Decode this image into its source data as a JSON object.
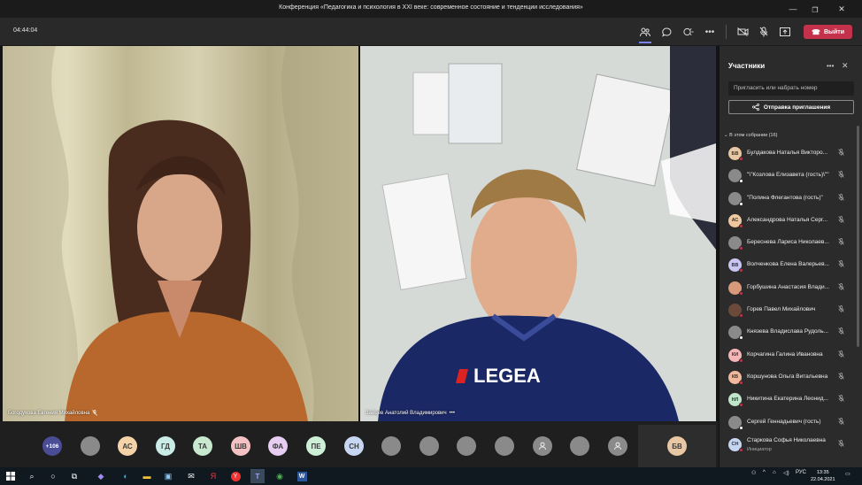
{
  "window": {
    "title": "Конференция «Педагогика и психология в XXI веке: современное состояние и тенденции исследования»",
    "minimize": "—",
    "maximize": "❐",
    "close": "✕"
  },
  "toolbar": {
    "timer": "04:44:04",
    "leave_label": "Выйти"
  },
  "videos": [
    {
      "name": "Богодухова Евгения Михайловна"
    },
    {
      "name": "Зайцев Анатолий Владимирович"
    }
  ],
  "strip": {
    "overflow": "+106",
    "initials": [
      "АС",
      "ГД",
      "ТА",
      "ШВ",
      "ФА",
      "ПЕ",
      "СН"
    ],
    "active_speaker": "БВ"
  },
  "panel": {
    "title": "Участники",
    "invite_placeholder": "Пригласить или набрать номер",
    "share_label": "Отправка приглашения",
    "section_label": "В этом собрании (16)",
    "participants": [
      {
        "initials": "БВ",
        "name": "Булдакова Наталья Викторо...",
        "color": "#e8c7a4",
        "status": "#c4314b"
      },
      {
        "initials": "",
        "name": "\"\\\"Козлова Елизавета (гость)\\\"\"",
        "color": "#8a8a8a",
        "status": "#ffffff"
      },
      {
        "initials": "",
        "name": "\"Полина Флегантова (гость)\"",
        "color": "#8a8a8a",
        "status": "#ffffff"
      },
      {
        "initials": "АС",
        "name": "Александрова Наталья Серг...",
        "color": "#f0c8a0",
        "status": "#c4314b"
      },
      {
        "initials": "",
        "name": "Береснева Лариса Николаев...",
        "color": "#8a8a8a",
        "status": "#c4314b"
      },
      {
        "initials": "ВВ",
        "name": "Волченкова Елена Валерьев...",
        "color": "#c9c6f2",
        "status": "#c4314b"
      },
      {
        "initials": "",
        "name": "Горбушина Анастасия Влади...",
        "color": "#d99a7c",
        "status": "#c4314b"
      },
      {
        "initials": "",
        "name": "Горев Павел Михайлович",
        "color": "#6b4a3a",
        "status": "#c4314b"
      },
      {
        "initials": "",
        "name": "Князева Владислава Рудоль...",
        "color": "#8a8a8a",
        "status": "#ffffff"
      },
      {
        "initials": "КИ",
        "name": "Корчагина Галина Ивановна",
        "color": "#f5b6b6",
        "status": "#c4314b"
      },
      {
        "initials": "КВ",
        "name": "Коршунова Ольга Витальевна",
        "color": "#f0b89c",
        "status": "#c4314b"
      },
      {
        "initials": "НЛ",
        "name": "Никитина Екатерина Леонид...",
        "color": "#bfe6c8",
        "status": "#c4314b"
      },
      {
        "initials": "",
        "name": "Сергей Геннадьевич (гость)",
        "color": "#8a8a8a",
        "status": "#ffffff"
      },
      {
        "initials": "СН",
        "name": "Старкова Софья Николаевна",
        "role": "Инициатор",
        "color": "#c5d6f2",
        "status": "#c4314b"
      }
    ]
  },
  "taskbar": {
    "lang": "РУС",
    "time": "13:35",
    "date": "22.04.2021"
  }
}
